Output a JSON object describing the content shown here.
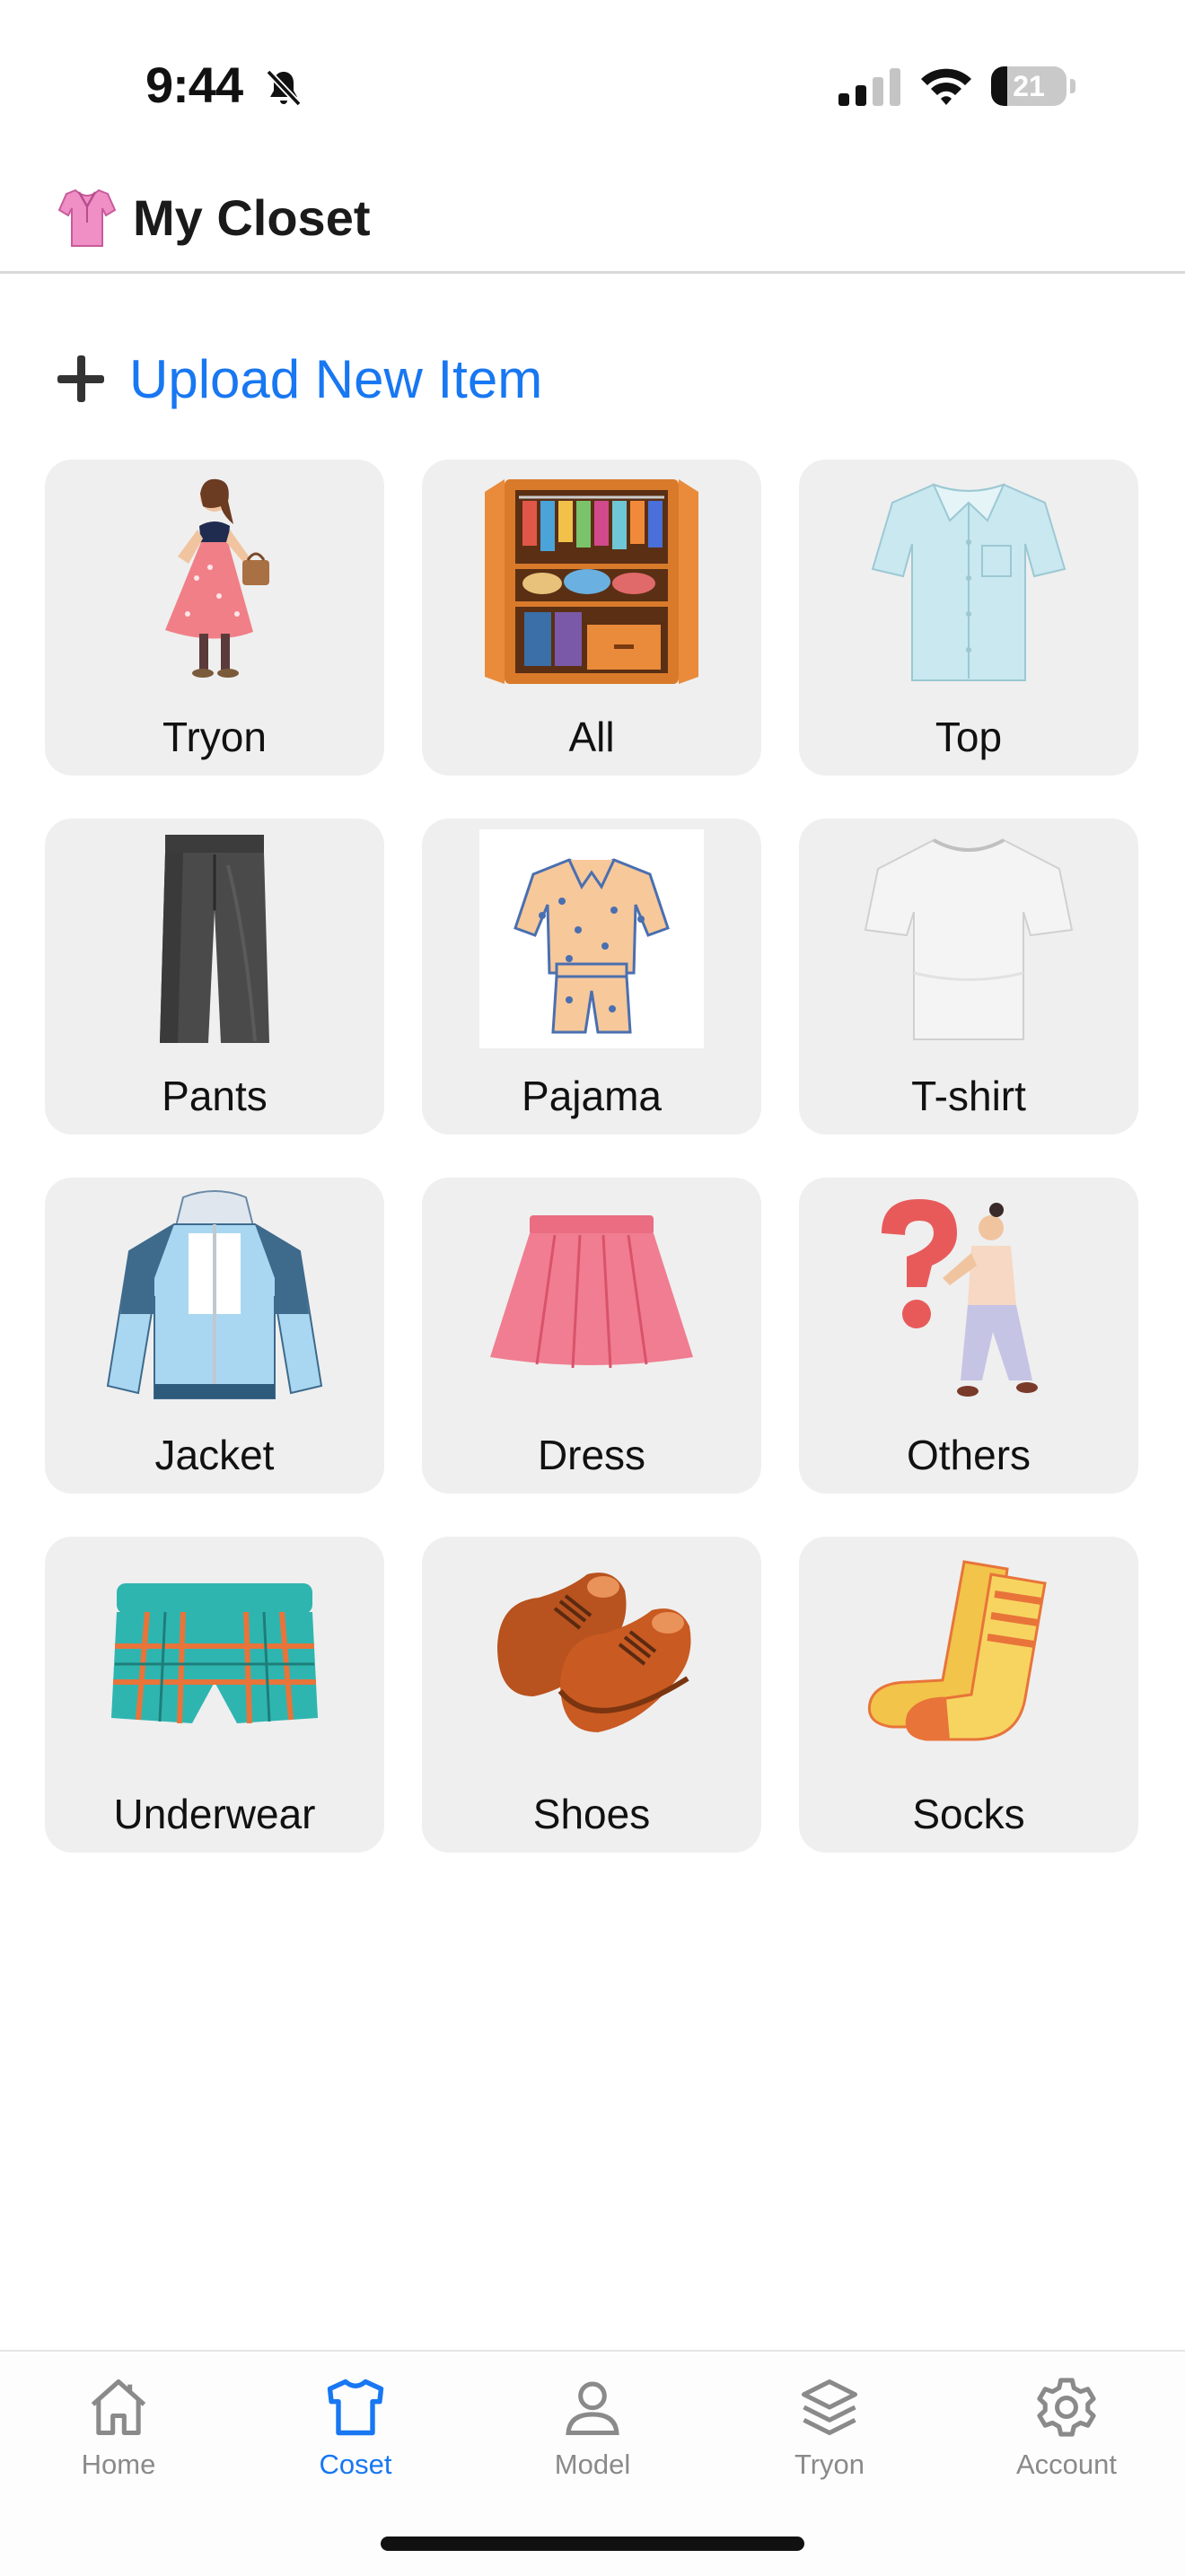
{
  "status": {
    "time": "9:44",
    "battery_level": "21",
    "battery_fraction": 0.21
  },
  "header": {
    "title": "My Closet",
    "icon": "pink-blouse-icon"
  },
  "upload": {
    "label": "Upload New Item",
    "icon": "plus-icon"
  },
  "categories": [
    {
      "label": "Tryon",
      "icon": "woman-in-dress-illustration"
    },
    {
      "label": "All",
      "icon": "wardrobe-illustration"
    },
    {
      "label": "Top",
      "icon": "shirt-illustration"
    },
    {
      "label": "Pants",
      "icon": "pants-illustration"
    },
    {
      "label": "Pajama",
      "icon": "pajama-illustration"
    },
    {
      "label": "T-shirt",
      "icon": "tshirt-illustration"
    },
    {
      "label": "Jacket",
      "icon": "jacket-illustration"
    },
    {
      "label": "Dress",
      "icon": "skirt-illustration"
    },
    {
      "label": "Others",
      "icon": "question-person-illustration"
    },
    {
      "label": "Underwear",
      "icon": "boxer-illustration"
    },
    {
      "label": "Shoes",
      "icon": "shoes-illustration"
    },
    {
      "label": "Socks",
      "icon": "socks-illustration"
    }
  ],
  "tabs": [
    {
      "label": "Home",
      "icon": "house-icon",
      "active": false
    },
    {
      "label": "Coset",
      "icon": "tshirt-icon",
      "active": true
    },
    {
      "label": "Model",
      "icon": "person-icon",
      "active": false
    },
    {
      "label": "Tryon",
      "icon": "layers-icon",
      "active": false
    },
    {
      "label": "Account",
      "icon": "gear-icon",
      "active": false
    }
  ],
  "colors": {
    "accent": "#1877f2",
    "card_bg": "#efefef",
    "inactive_tab": "#8a8a8a"
  }
}
